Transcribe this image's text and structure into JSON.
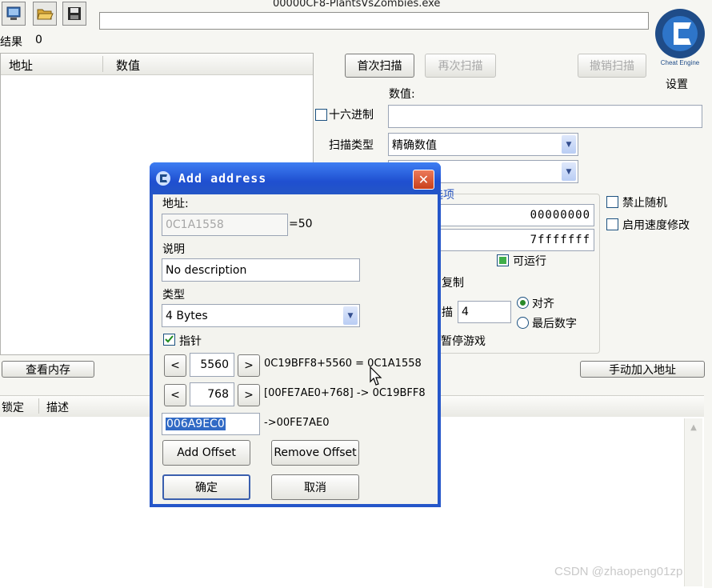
{
  "window": {
    "title": "00000CF8-PlantsVsZombies.exe",
    "progress": ""
  },
  "toolbar": {
    "open_process_icon": "computer-icon",
    "open_file_icon": "folder-open-icon",
    "save_icon": "floppy-icon"
  },
  "results": {
    "label": "结果",
    "count": "0"
  },
  "found_list": {
    "col_address": "地址",
    "col_value": "数值"
  },
  "scan": {
    "first_scan": "首次扫描",
    "next_scan": "再次扫描",
    "undo_scan": "撤销扫描",
    "value_label": "数值:",
    "value_input": "",
    "hex_label": "十六进制",
    "scan_type_label": "扫描类型",
    "scan_type_value": "精确数值",
    "value_type_value": "",
    "options_label": "选项",
    "start_addr": "00000000",
    "stop_addr": "7fffffff",
    "executable_label": "可运行",
    "copy_label": "复制",
    "scan_label_fragment": "描",
    "fast_scan_value": "4",
    "align_label": "对齐",
    "last_digits_label": "最后数字",
    "pause_game_label": "暂停游戏",
    "disable_random_label": "禁止随机",
    "enable_speedhack_label": "启用速度修改"
  },
  "logo": {
    "settings_label": "设置",
    "brand": "Cheat Engine"
  },
  "buttons": {
    "memory_view": "查看内存",
    "add_address_manually": "手动加入地址"
  },
  "address_list": {
    "col_lock": "锁定",
    "col_desc": "描述"
  },
  "dialog": {
    "title": "Add address",
    "close_icon": "close-x-icon",
    "address_label": "地址:",
    "address_value": "0C1A1558",
    "address_result": "=50",
    "desc_label": "说明",
    "desc_value": "No description",
    "type_label": "类型",
    "type_value": "4 Bytes",
    "pointer_label": "指针",
    "offset1": {
      "value": "5560",
      "expr": "0C19BFF8+5560 = 0C1A1558"
    },
    "offset2": {
      "value": "768",
      "expr": "[00FE7AE0+768] -> 0C19BFF8"
    },
    "base_address": "006A9EC0",
    "base_result": "->00FE7AE0",
    "add_offset": "Add Offset",
    "remove_offset": "Remove Offset",
    "ok": "确定",
    "cancel": "取消",
    "dec_symbol": "<",
    "inc_symbol": ">"
  },
  "watermark": "CSDN @zhaopeng01zp",
  "colors": {
    "dialog_blue": "#2556c9",
    "close_red": "#d8512d",
    "selection_blue": "#316ac5",
    "window_bg": "#f6f6f2"
  }
}
